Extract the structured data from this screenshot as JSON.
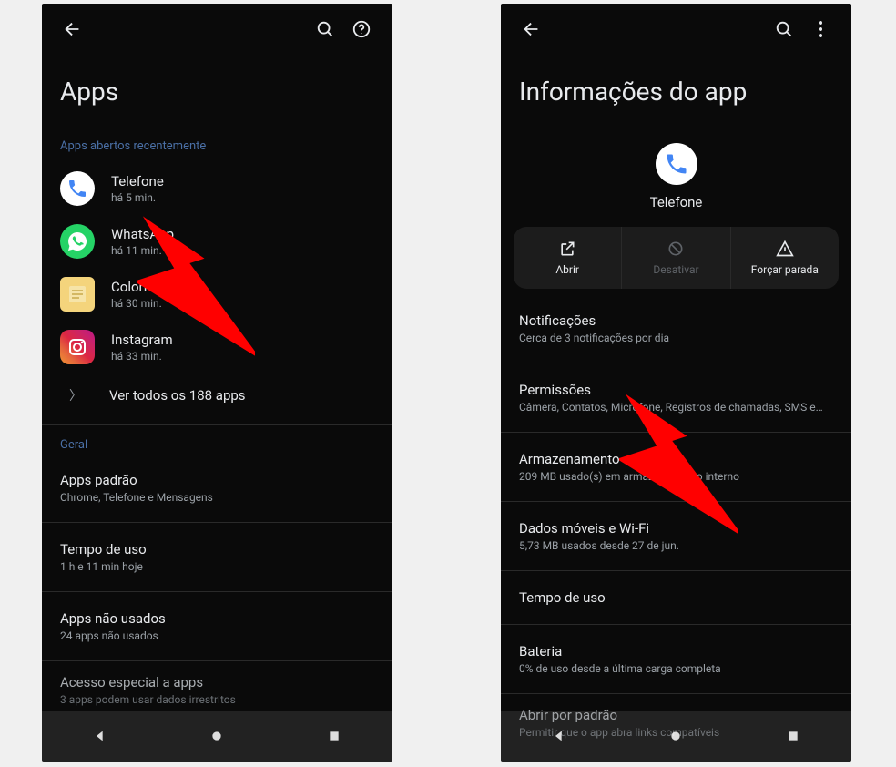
{
  "left": {
    "title": "Apps",
    "section_recent": "Apps abertos recentemente",
    "apps": [
      {
        "name": "Telefone",
        "sub": "há 5 min."
      },
      {
        "name": "WhatsApp",
        "sub": "há 11 min."
      },
      {
        "name": "ColorNote",
        "sub": "há 30 min."
      },
      {
        "name": "Instagram",
        "sub": "há 33 min."
      }
    ],
    "see_all": "Ver todos os 188 apps",
    "section_general": "Geral",
    "default_apps": {
      "title": "Apps padrão",
      "sub": "Chrome, Telefone e Mensagens"
    },
    "screen_time": {
      "title": "Tempo de uso",
      "sub": "1 h e 11 min hoje"
    },
    "unused_apps": {
      "title": "Apps não usados",
      "sub": "24 apps não usados"
    },
    "special_access": {
      "title": "Acesso especial a apps",
      "sub": "3 apps podem usar dados irrestritos"
    }
  },
  "right": {
    "title": "Informações do app",
    "app_name": "Telefone",
    "actions": {
      "open": "Abrir",
      "disable": "Desativar",
      "force_stop": "Forçar parada"
    },
    "notifications": {
      "title": "Notificações",
      "sub": "Cerca de 3 notificações por dia"
    },
    "permissions": {
      "title": "Permissões",
      "sub": "Câmera, Contatos, Microfone, Registros de chamadas, SMS e…"
    },
    "storage": {
      "title": "Armazenamento e cache",
      "sub": "209 MB usado(s) em armazenamento interno"
    },
    "data": {
      "title": "Dados móveis e Wi-Fi",
      "sub": "5,73 MB usados desde 27 de jun."
    },
    "screen_time": {
      "title": "Tempo de uso"
    },
    "battery": {
      "title": "Bateria",
      "sub": "0% de uso desde a última carga completa"
    },
    "open_default": {
      "title": "Abrir por padrão",
      "sub": "Permitir que o app abra links compatíveis"
    }
  },
  "colors": {
    "phone_blue": "#4285f4",
    "whatsapp_green": "#25d366",
    "note_yellow": "#f4d47c"
  }
}
